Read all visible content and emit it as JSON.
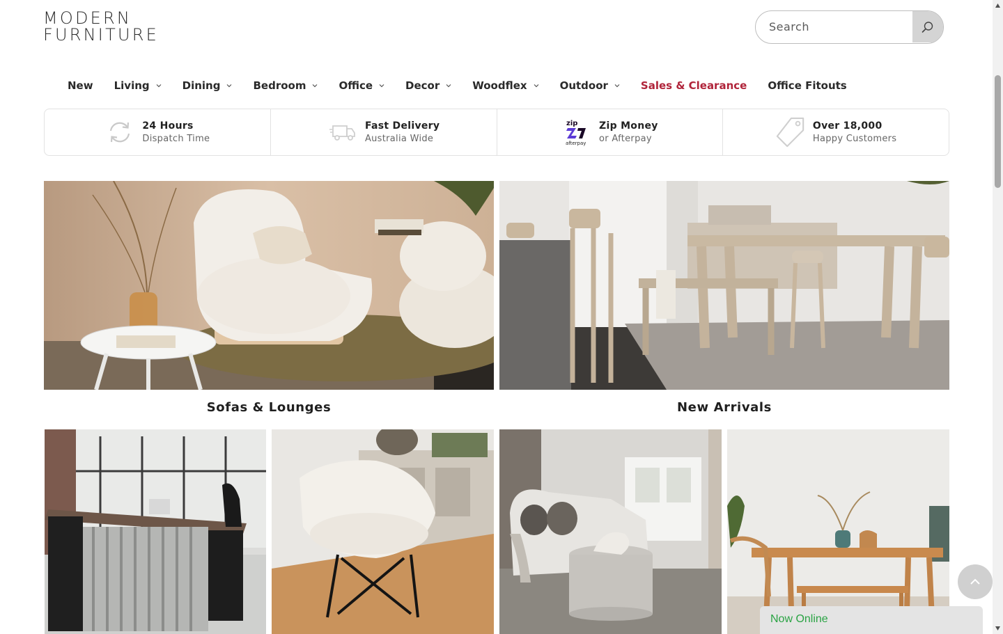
{
  "header": {
    "logo_line1": "MODERN",
    "logo_line2": "FURNITURE",
    "search_placeholder": "Search"
  },
  "nav": {
    "items": [
      {
        "label": "New",
        "has_dropdown": false
      },
      {
        "label": "Living",
        "has_dropdown": true
      },
      {
        "label": "Dining",
        "has_dropdown": true
      },
      {
        "label": "Bedroom",
        "has_dropdown": true
      },
      {
        "label": "Office",
        "has_dropdown": true
      },
      {
        "label": "Decor",
        "has_dropdown": true
      },
      {
        "label": "Woodflex",
        "has_dropdown": true
      },
      {
        "label": "Outdoor",
        "has_dropdown": true
      },
      {
        "label": "Sales & Clearance",
        "has_dropdown": false
      },
      {
        "label": "Office Fitouts",
        "has_dropdown": false
      }
    ],
    "sale_color": "#b0243a"
  },
  "usp": [
    {
      "icon": "refresh-icon",
      "title": "24 Hours",
      "subtitle": "Dispatch Time"
    },
    {
      "icon": "truck-icon",
      "title": "Fast Delivery",
      "subtitle": "Australia Wide"
    },
    {
      "icon": "zip-afterpay-logo",
      "title": "Zip Money",
      "subtitle": "or Afterpay",
      "logo_top": "zip",
      "logo_bottom": "afterpay"
    },
    {
      "icon": "price-tag-icon",
      "title": "Over 18,000",
      "subtitle": "Happy Customers"
    }
  ],
  "categories": [
    {
      "caption": "Sofas & Lounges",
      "image": "boucle-swivel-chair-photo"
    },
    {
      "caption": "New Arrivals",
      "image": "dining-room-set-photo"
    }
  ],
  "lower_tiles": [
    {
      "image": "executive-office-desk-photo"
    },
    {
      "image": "boucle-egg-chair-photo"
    },
    {
      "image": "curved-sofa-and-coffee-table-photo"
    },
    {
      "image": "timber-dining-set-photo"
    }
  ],
  "widgets": {
    "chat_label": "Now Online",
    "chat_color": "#2aa344"
  }
}
